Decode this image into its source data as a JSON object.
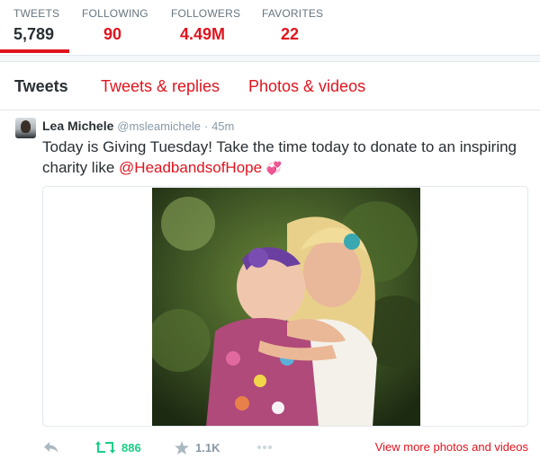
{
  "stats": [
    {
      "label": "TWEETS",
      "value": "5,789"
    },
    {
      "label": "FOLLOWING",
      "value": "90"
    },
    {
      "label": "FOLLOWERS",
      "value": "4.49M"
    },
    {
      "label": "FAVORITES",
      "value": "22"
    }
  ],
  "tabs": [
    {
      "label": "Tweets"
    },
    {
      "label": "Tweets & replies"
    },
    {
      "label": "Photos & videos"
    }
  ],
  "tweet": {
    "name": "Lea Michele",
    "handle": "@msleamichele",
    "separator": "·",
    "time": "45m",
    "text_line1": "Today is Giving Tuesday! Take the time today to donate to an inspiring",
    "text_line2_prefix": "charity like ",
    "mention": "@HeadbandsofHope",
    "emoji": "💞"
  },
  "actions": {
    "retweet_count": "886",
    "favorite_count": "1.1K",
    "more_label": "View more photos and videos"
  },
  "colors": {
    "accent": "#e0141e",
    "retweet": "#19cf86",
    "muted": "#8899a6"
  }
}
